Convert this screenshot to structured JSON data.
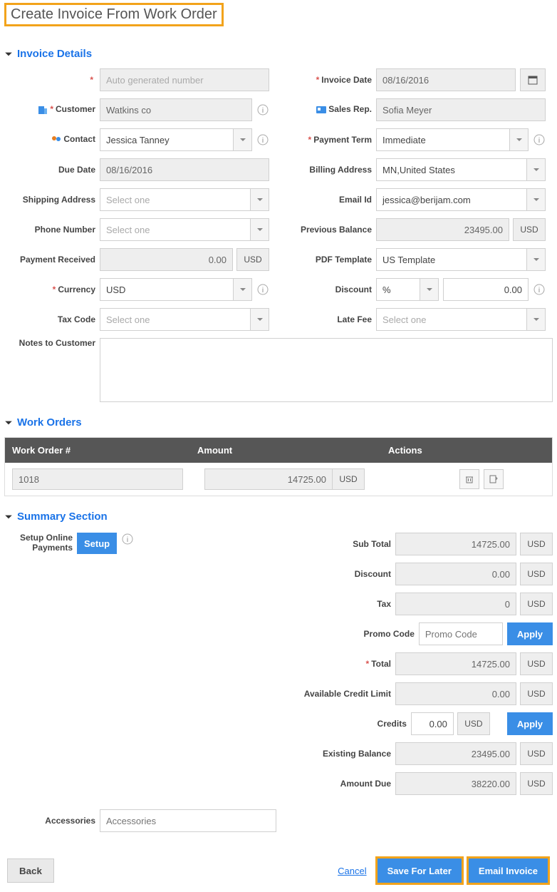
{
  "page_title": "Create Invoice From Work Order",
  "sections": {
    "details": "Invoice Details",
    "work_orders": "Work Orders",
    "summary": "Summary Section"
  },
  "labels": {
    "auto_num_ph": "Auto generated number",
    "customer": "Customer",
    "contact": "Contact",
    "due_date": "Due Date",
    "shipping": "Shipping Address",
    "phone": "Phone Number",
    "pay_recv": "Payment Received",
    "currency": "Currency",
    "tax_code": "Tax Code",
    "notes": "Notes to Customer",
    "inv_date": "Invoice Date",
    "sales_rep": "Sales Rep.",
    "pay_term": "Payment Term",
    "bill_addr": "Billing Address",
    "email": "Email Id",
    "prev_bal": "Previous Balance",
    "pdf_tmpl": "PDF Template",
    "discount": "Discount",
    "late_fee": "Late Fee",
    "select_one": "Select one",
    "usd": "USD",
    "setup_online": "Setup Online Payments",
    "setup_btn": "Setup",
    "sub_total": "Sub Total",
    "tax": "Tax",
    "promo": "Promo Code",
    "promo_ph": "Promo Code",
    "apply": "Apply",
    "total": "Total",
    "avail_credit": "Available Credit Limit",
    "credits": "Credits",
    "exist_bal": "Existing Balance",
    "amt_due": "Amount Due",
    "accessories": "Accessories",
    "accessories_ph": "Accessories",
    "pct": "%"
  },
  "values": {
    "customer": "Watkins co",
    "contact": "Jessica Tanney",
    "due_date": "08/16/2016",
    "pay_recv": "0.00",
    "currency": "USD",
    "inv_date": "08/16/2016",
    "sales_rep": "Sofia Meyer",
    "pay_term": "Immediate",
    "bill_addr": "MN,United States",
    "email": "jessica@berijam.com",
    "prev_bal": "23495.00",
    "pdf_tmpl": "US Template",
    "disc_val": "0.00"
  },
  "table": {
    "h1": "Work Order #",
    "h2": "Amount",
    "h3": "Actions",
    "row": {
      "num": "1018",
      "amount": "14725.00"
    }
  },
  "summary": {
    "sub_total": "14725.00",
    "discount": "0.00",
    "tax": "0",
    "total": "14725.00",
    "avail": "0.00",
    "credits": "0.00",
    "exist": "23495.00",
    "due": "38220.00"
  },
  "footer": {
    "back": "Back",
    "cancel": "Cancel",
    "save": "Save For Later",
    "email": "Email Invoice"
  }
}
